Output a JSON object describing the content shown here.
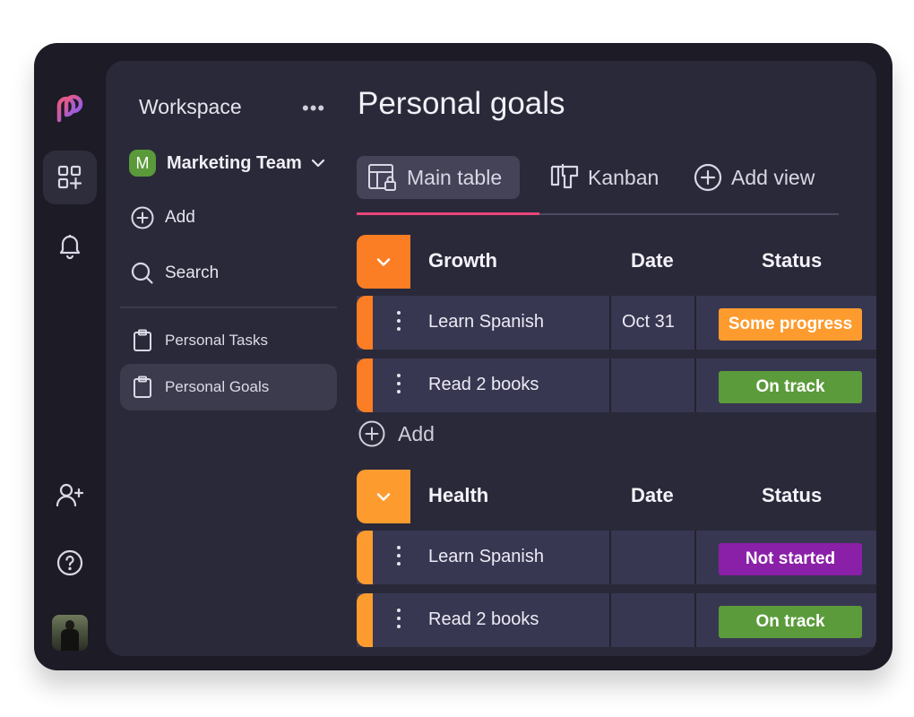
{
  "colors": {
    "frame_bg": "#1c1b26",
    "panel_bg": "#2a2939",
    "row_bg": "#383752",
    "growth_accent": "#fb7d24",
    "health_accent": "#fd9b2e",
    "tab_underline": "#e8457a",
    "logo_gradient": [
      "#f05a78",
      "#8a5cf6"
    ],
    "team_badge": "#5a9a3a"
  },
  "rail": {
    "icons": [
      "logo-icon",
      "dashboard-add-icon",
      "bell-icon",
      "add-user-icon",
      "help-icon",
      "user-avatar"
    ]
  },
  "sidebar": {
    "title": "Workspace",
    "more": "•••",
    "team": {
      "badge": "M",
      "name": "Marketing Team"
    },
    "add_label": "Add",
    "search_label": "Search",
    "pages": [
      {
        "label": "Personal Tasks",
        "selected": false
      },
      {
        "label": "Personal Goals",
        "selected": true
      }
    ]
  },
  "main": {
    "title": "Personal goals",
    "tabs": [
      {
        "label": "Main table",
        "active": true
      },
      {
        "label": "Kanban",
        "active": false
      },
      {
        "label": "Add view",
        "active": false
      }
    ],
    "groups": [
      {
        "name": "Growth",
        "col_date": "Date",
        "col_status": "Status",
        "rows": [
          {
            "name": "Learn Spanish",
            "date": "Oct 31",
            "status": "Some progress",
            "status_color": "#fd9b2e"
          },
          {
            "name": "Read 2 books",
            "date": "",
            "status": "On track",
            "status_color": "#5b9b3b"
          }
        ],
        "add_label": "Add"
      },
      {
        "name": "Health",
        "col_date": "Date",
        "col_status": "Status",
        "rows": [
          {
            "name": "Learn Spanish",
            "date": "",
            "status": "Not started",
            "status_color": "#8a1fa8"
          },
          {
            "name": "Read 2 books",
            "date": "",
            "status": "On track",
            "status_color": "#5b9b3b"
          }
        ]
      }
    ]
  }
}
